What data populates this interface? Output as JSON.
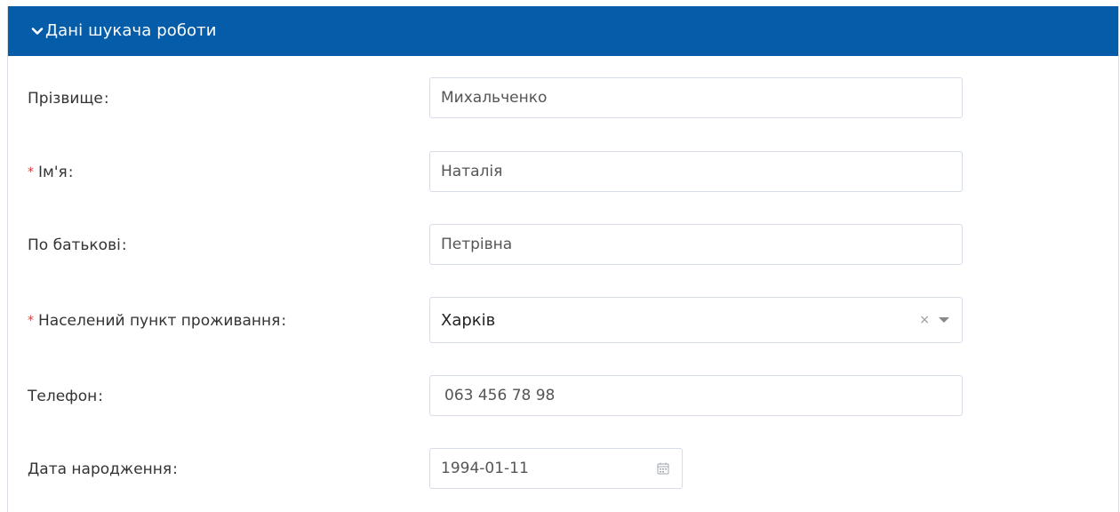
{
  "panel": {
    "title": "Дані шукача роботи",
    "header_color": "#055ca9"
  },
  "fields": {
    "surname": {
      "label": "Прізвище",
      "value": "Михальченко",
      "required": false
    },
    "first_name": {
      "label": "Ім'я",
      "value": "Наталія",
      "required": true
    },
    "patronymic": {
      "label": "По батькові",
      "value": "Петрівна",
      "required": false
    },
    "city": {
      "label": "Населений пункт проживання",
      "value": "Харків",
      "required": true,
      "clear_symbol": "×"
    },
    "phone": {
      "label": "Телефон",
      "value": "063 456 78 98",
      "required": false
    },
    "birth_date": {
      "label": "Дата народження",
      "value": "1994-01-11",
      "required": false
    }
  },
  "required_marker": "*",
  "colon": ":",
  "icons": {
    "header": "chevron-down-icon",
    "select_clear": "clear-icon",
    "select_toggle": "caret-down-icon",
    "date": "calendar-icon"
  }
}
